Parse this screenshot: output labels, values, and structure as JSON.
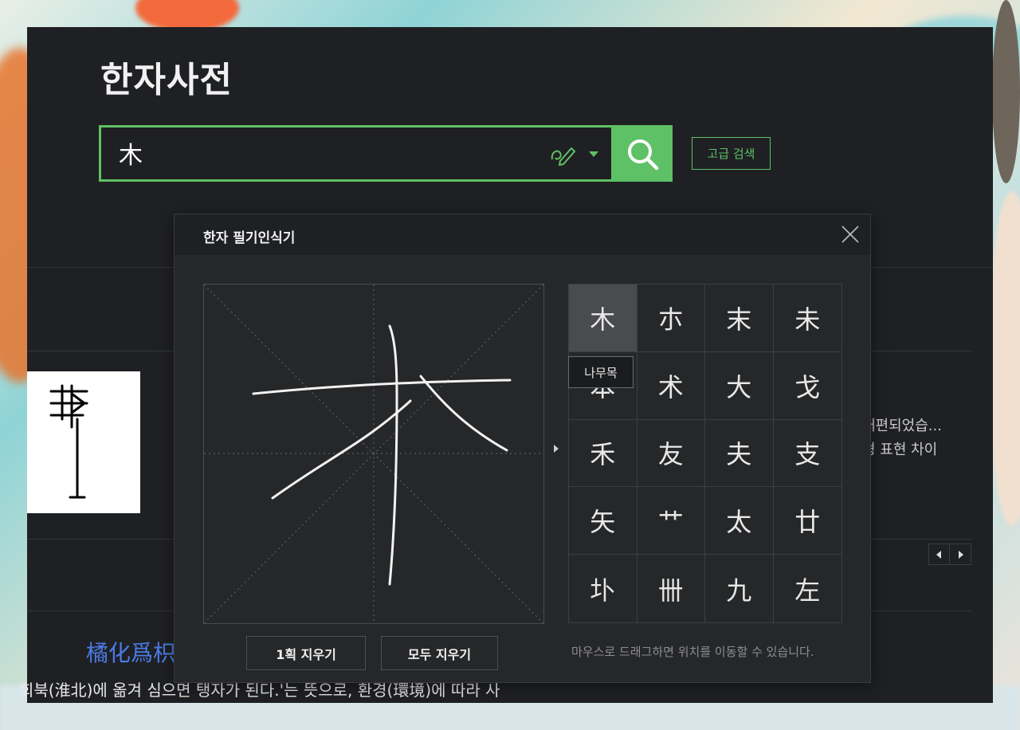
{
  "app": {
    "title": "한자사전"
  },
  "search": {
    "value": "木",
    "advanced_label": "고급 검색"
  },
  "background": {
    "related_lines": [
      "개편되었습...",
      "형 표현 차이"
    ],
    "idiom_title": "橘化爲枳",
    "idiom_desc": "회북(淮北)에 옮겨 심으면 탱자가 된다.'는 뜻으로, 환경(環境)에 따라 사"
  },
  "popup": {
    "title": "한자 필기인식기",
    "candidates": [
      "木",
      "朩",
      "末",
      "未",
      "本",
      "术",
      "大",
      "戈",
      "禾",
      "友",
      "夫",
      "支",
      "矢",
      "艹",
      "太",
      "廿",
      "圤",
      "卌",
      "九",
      "左"
    ],
    "tooltip": "나무목",
    "undo_label": "1획 지우기",
    "clear_label": "모두 지우기",
    "hint": "마우스로 드래그하면 위치를 이동할 수 있습니다."
  },
  "colors": {
    "accent": "#5ec165",
    "panel": "#1f2023",
    "link": "#4a7ce8"
  }
}
